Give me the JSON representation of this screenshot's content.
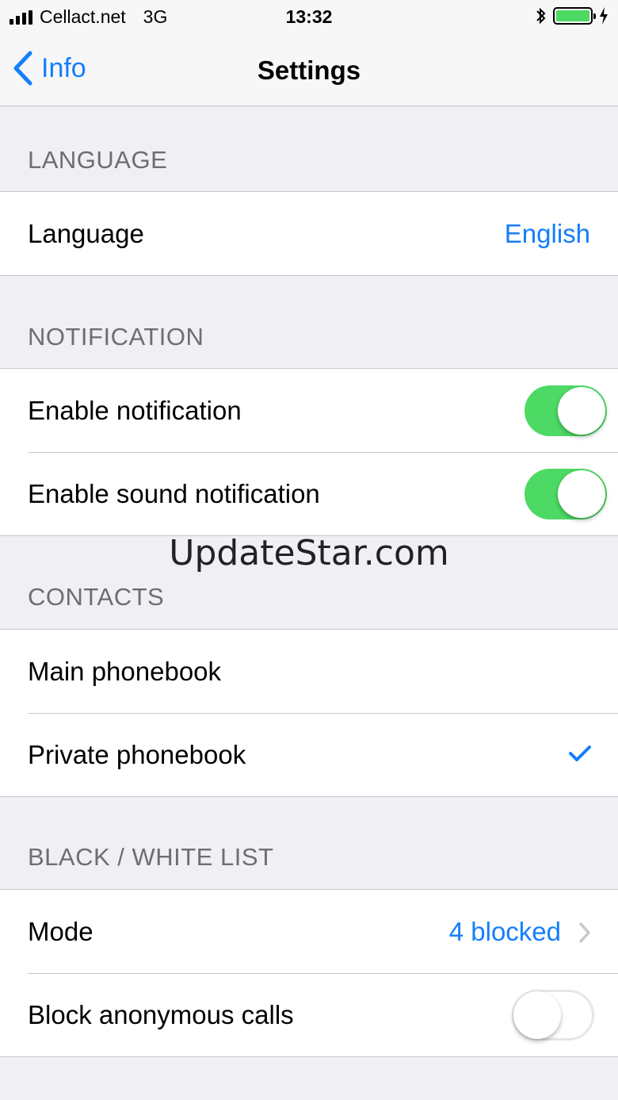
{
  "status_bar": {
    "carrier": "Cellact.net",
    "network": "3G",
    "time": "13:32",
    "battery_color": "#4cd964"
  },
  "nav": {
    "back_label": "Info",
    "title": "Settings"
  },
  "sections": {
    "language": {
      "header": "LANGUAGE",
      "row_label": "Language",
      "row_value": "English"
    },
    "notification": {
      "header": "NOTIFICATION",
      "enable_notification": {
        "label": "Enable notification",
        "on": true
      },
      "enable_sound": {
        "label": "Enable sound notification",
        "on": true
      }
    },
    "contacts": {
      "header": "CONTACTS",
      "main": {
        "label": "Main phonebook",
        "selected": false
      },
      "private": {
        "label": "Private phonebook",
        "selected": true
      }
    },
    "blacklist": {
      "header": "BLACK / WHITE LIST",
      "mode": {
        "label": "Mode",
        "value": "4 blocked"
      },
      "anonymous": {
        "label": "Block anonymous calls",
        "on": false
      }
    }
  },
  "watermark": "UpdateStar.com",
  "colors": {
    "accent": "#157efb",
    "toggle_on": "#4cd964",
    "background": "#efeff4"
  }
}
